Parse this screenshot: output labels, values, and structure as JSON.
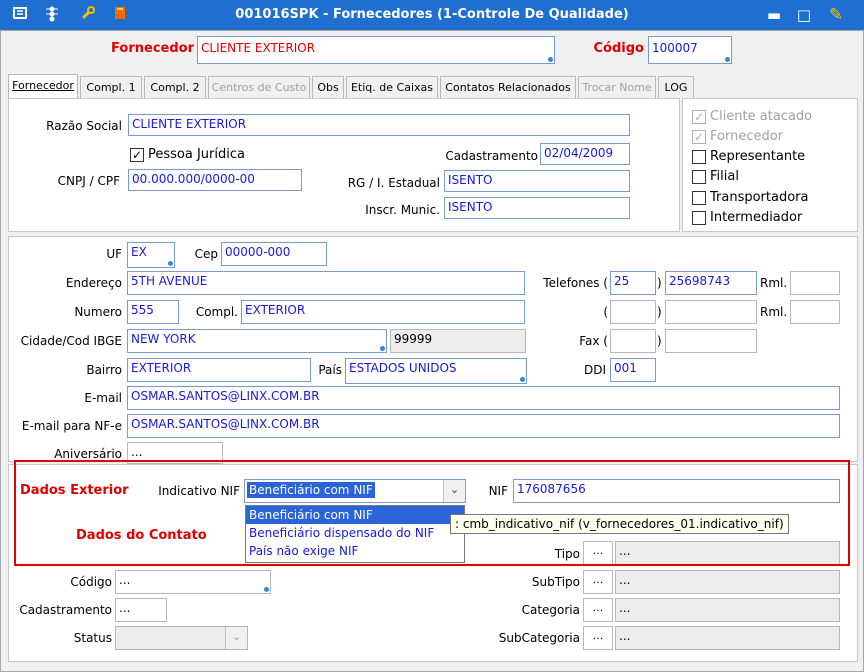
{
  "window": {
    "title": "001016SPK - Fornecedores (1-Controle De Qualidade)",
    "minimize": "▬",
    "maximize": "□",
    "edit": "✎"
  },
  "header": {
    "fornecedor_label": "Fornecedor",
    "fornecedor_value": "CLIENTE EXTERIOR",
    "codigo_label": "Código",
    "codigo_value": "100007"
  },
  "tabs": [
    {
      "label": "Fornecedor"
    },
    {
      "label": "Compl. 1"
    },
    {
      "label": "Compl. 2"
    },
    {
      "label": "Centros de Custo"
    },
    {
      "label": "Obs"
    },
    {
      "label": "Etiq. de Caixas"
    },
    {
      "label": "Contatos Relacionados"
    },
    {
      "label": "Trocar Nome"
    },
    {
      "label": "LOG"
    }
  ],
  "general": {
    "razao_label": "Razão Social",
    "razao_value": "CLIENTE EXTERIOR",
    "pj_label": "Pessoa Jurídica",
    "cadastramento_label": "Cadastramento",
    "cadastramento_value": "02/04/2009",
    "cnpj_label": "CNPJ / CPF",
    "cnpj_value": "00.000.000/0000-00",
    "rg_label": "RG / I. Estadual",
    "rg_value": "ISENTO",
    "inscr_label": "Inscr. Munic.",
    "inscr_value": "ISENTO"
  },
  "flags": [
    {
      "label": "Cliente atacado",
      "checked": true
    },
    {
      "label": "Fornecedor",
      "checked": true
    },
    {
      "label": "Representante",
      "checked": false
    },
    {
      "label": "Filial",
      "checked": false
    },
    {
      "label": "Transportadora",
      "checked": false
    },
    {
      "label": "Intermediador",
      "checked": false
    }
  ],
  "address": {
    "uf_label": "UF",
    "uf_value": "EX",
    "cep_label": "Cep",
    "cep_value": "00000-000",
    "endereco_label": "Endereço",
    "endereco_value": "5TH AVENUE",
    "telefones_label": "Telefones (",
    "tel_ddd": "25",
    "tel_number": "25698743",
    "rml_label": "Rml.",
    "numero_label": "Numero",
    "numero_value": "555",
    "compl_label": "Compl.",
    "compl_value": "EXTERIOR",
    "paren_open": "(",
    "paren_close": ")",
    "cidade_label": "Cidade/Cod IBGE",
    "cidade_value": "NEW YORK",
    "ibge_value": "99999",
    "fax_label": "Fax (",
    "bairro_label": "Bairro",
    "bairro_value": "EXTERIOR",
    "pais_label": "País",
    "pais_value": "ESTADOS UNIDOS",
    "ddi_label": "DDI",
    "ddi_value": "001",
    "email_label": "E-mail",
    "email_value": "OSMAR.SANTOS@LINX.COM.BR",
    "email_nfe_label": "E-mail para NF-e",
    "email_nfe_value": "OSMAR.SANTOS@LINX.COM.BR",
    "aniversario_label": "Aniversário",
    "aniversario_value": "..."
  },
  "exterior": {
    "title": "Dados Exterior",
    "indicativo_label": "Indicativo NIF",
    "indicativo_value": "Beneficiário com NIF",
    "nif_label": "NIF",
    "nif_value": "176087656",
    "options": [
      "Beneficiário com NIF",
      "Beneficiário dispensado do NIF",
      "País não exige NIF"
    ],
    "tooltip": ": cmb_indicativo_nif (v_fornecedores_01.indicativo_nif)"
  },
  "contato": {
    "title": "Dados do Contato",
    "tipo_label": "Tipo",
    "codigo_label": "Código",
    "codigo_value": "...",
    "subtipo_label": "SubTipo",
    "cadastramento_label": "Cadastramento",
    "cadastramento_value": "...",
    "categoria_label": "Categoria",
    "status_label": "Status",
    "subcategoria_label": "SubCategoria",
    "ellipsis": "...",
    "arrow": "⌄"
  },
  "colors": {
    "titlebar": "#1e6fd0",
    "accent_red": "#e00000",
    "field_text": "#1a1ad0",
    "selection": "#2a64d6"
  }
}
